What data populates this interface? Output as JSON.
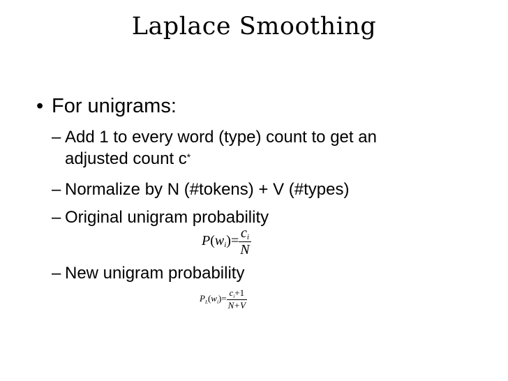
{
  "slide": {
    "title": "Laplace Smoothing",
    "bullet": {
      "marker": "•",
      "text": "For unigrams:"
    },
    "items": [
      {
        "dash": "–",
        "line1": "Add 1 to every word (type) count  to get an",
        "line2": "adjusted count c",
        "sup": "*"
      },
      {
        "dash": "–",
        "text": "Normalize by N (#tokens) + V (#types)"
      },
      {
        "dash": "–",
        "text": "Original unigram probability"
      },
      {
        "dash": "–",
        "text": "New unigram probability"
      }
    ],
    "formula1": {
      "lhs_p": "P",
      "lp": "(",
      "w": "w",
      "i": "i",
      "rp": ")",
      "eq": "=",
      "num_c": "c",
      "num_i": "i",
      "den": "N"
    },
    "formula2": {
      "lhs_p": "P",
      "lhs_sub": "L",
      "lp": "(",
      "w": "w",
      "i": "i",
      "rp": ")",
      "eq": "=",
      "num_c": "c",
      "num_i": "i",
      "num_plus": "+1",
      "den": "N+V"
    }
  }
}
